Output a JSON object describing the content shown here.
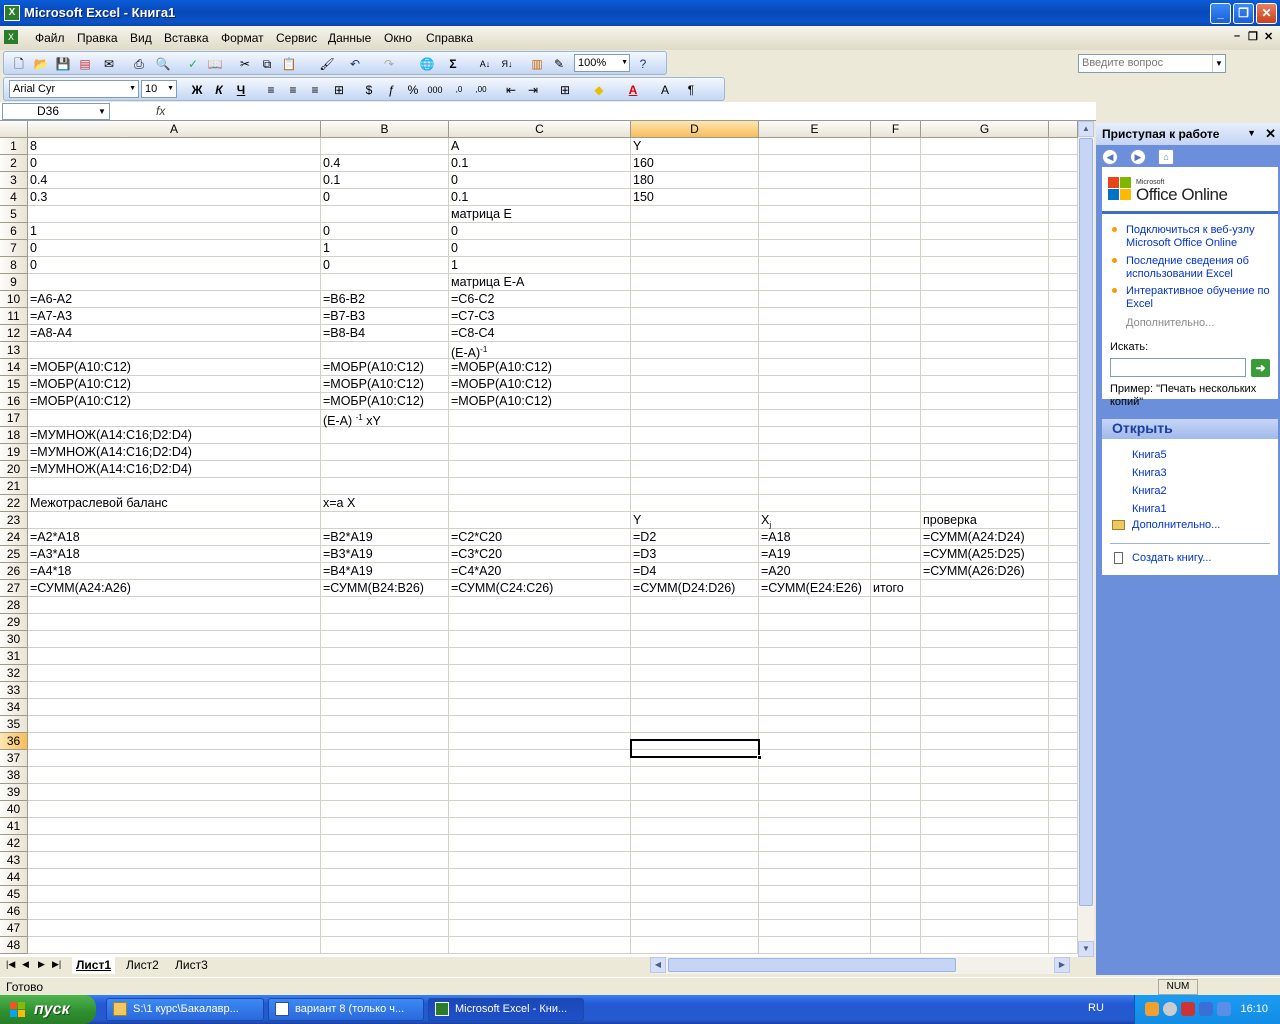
{
  "window": {
    "title": "Microsoft Excel - Книга1",
    "app_icon": "excel-icon"
  },
  "menu": {
    "items": [
      "Файл",
      "Правка",
      "Вид",
      "Вставка",
      "Формат",
      "Сервис",
      "Данные",
      "Окно",
      "Справка"
    ],
    "help_placeholder": "Введите вопрос"
  },
  "toolbar": {
    "zoom": "100%",
    "font_name": "Arial Cyr",
    "font_size": "10",
    "bold_label": "Ж",
    "italic_label": "К",
    "underline_label": "Ч"
  },
  "formula_bar": {
    "name_box": "D36",
    "fx": "fx",
    "content": ""
  },
  "columns": [
    "A",
    "B",
    "C",
    "D",
    "E",
    "F",
    "G"
  ],
  "selected_column": "D",
  "selected_row": 36,
  "rows": [
    {
      "n": 1,
      "A": "8",
      "C": "A",
      "D": "Y"
    },
    {
      "n": 2,
      "A": "0",
      "B": "0.4",
      "C": "0.1",
      "D": "160"
    },
    {
      "n": 3,
      "A": "0.4",
      "B": "0.1",
      "C": "0",
      "D": "180"
    },
    {
      "n": 4,
      "A": "0.3",
      "B": "0",
      "C": "0.1",
      "D": "150"
    },
    {
      "n": 5,
      "C": "матрица E"
    },
    {
      "n": 6,
      "A": "1",
      "B": "0",
      "C": "0"
    },
    {
      "n": 7,
      "A": "0",
      "B": "1",
      "C": "0"
    },
    {
      "n": 8,
      "A": "0",
      "B": "0",
      "C": "1"
    },
    {
      "n": 9,
      "C": "матрица E-A"
    },
    {
      "n": 10,
      "A": "=A6-A2",
      "B": "=B6-B2",
      "C": "=C6-C2"
    },
    {
      "n": 11,
      "A": "=A7-A3",
      "B": "=B7-B3",
      "C": "=C7-C3"
    },
    {
      "n": 12,
      "A": "=A8-A4",
      "B": "=B8-B4",
      "C": "=C8-C4"
    },
    {
      "n": 13,
      "C": "(E-A)",
      "C_sup": "-1"
    },
    {
      "n": 14,
      "A": "=МОБР(A10:C12)",
      "B": "=МОБР(A10:C12)",
      "C": "=МОБР(A10:C12)"
    },
    {
      "n": 15,
      "A": "=МОБР(A10:C12)",
      "B": "=МОБР(A10:C12)",
      "C": "=МОБР(A10:C12)"
    },
    {
      "n": 16,
      "A": "=МОБР(A10:C12)",
      "B": "=МОБР(A10:C12)",
      "C": "=МОБР(A10:C12)"
    },
    {
      "n": 17,
      "B": "(E-A) ",
      "B_sup": "-1",
      "B_after": " xY"
    },
    {
      "n": 18,
      "A": "=МУМНОЖ(A14:C16;D2:D4)"
    },
    {
      "n": 19,
      "A": "=МУМНОЖ(A14:C16;D2:D4)"
    },
    {
      "n": 20,
      "A": "=МУМНОЖ(A14:C16;D2:D4)"
    },
    {
      "n": 21
    },
    {
      "n": 22,
      "A": "Межотраслевой баланс",
      "B": "x=a X"
    },
    {
      "n": 23,
      "D": "Y",
      "E": "X",
      "E_sub": "j",
      "G": "проверка"
    },
    {
      "n": 24,
      "A": "=A2*A18",
      "B": "=B2*A19",
      "C": "=C2*C20",
      "D": "=D2",
      "E": "=A18",
      "G": "=СУММ(A24:D24)"
    },
    {
      "n": 25,
      "A": "=A3*A18",
      "B": "=B3*A19",
      "C": "=C3*C20",
      "D": "=D3",
      "E": "=A19",
      "G": "=СУММ(A25:D25)"
    },
    {
      "n": 26,
      "A": "=A4*18",
      "B": "=B4*A19",
      "C": "=C4*A20",
      "D": "=D4",
      "E": "=A20",
      "G": "=СУММ(A26:D26)"
    },
    {
      "n": 27,
      "A": "=СУММ(A24:A26)",
      "B": "=СУММ(B24:B26)",
      "C": "=СУММ(C24:C26)",
      "D": "=СУММ(D24:D26)",
      "E": "=СУММ(E24:E26)",
      "F": "итого"
    },
    {
      "n": 28
    },
    {
      "n": 29
    },
    {
      "n": 30
    },
    {
      "n": 31
    },
    {
      "n": 32
    },
    {
      "n": 33
    },
    {
      "n": 34
    },
    {
      "n": 35
    },
    {
      "n": 36
    },
    {
      "n": 37
    },
    {
      "n": 38
    },
    {
      "n": 39
    },
    {
      "n": 40
    },
    {
      "n": 41
    },
    {
      "n": 42
    },
    {
      "n": 43
    },
    {
      "n": 44
    },
    {
      "n": 45
    },
    {
      "n": 46
    },
    {
      "n": 47
    },
    {
      "n": 48
    }
  ],
  "sheet_tabs": [
    "Лист1",
    "Лист2",
    "Лист3"
  ],
  "active_tab": "Лист1",
  "status": {
    "text": "Готово",
    "num": "NUM"
  },
  "task_pane": {
    "title": "Приступая к работе",
    "office_online_small": "Microsoft",
    "office_online": "Office Online",
    "links": [
      "Подключиться к веб-узлу Microsoft Office Online",
      "Последние сведения об использовании Excel",
      "Интерактивное обучение по Excel"
    ],
    "more": "Дополнительно...",
    "search_label": "Искать:",
    "search_value": "",
    "example_label": "Пример:",
    "example_text": "\"Печать нескольких копий\"",
    "open_header": "Открыть",
    "recent": [
      "Книга5",
      "Книга3",
      "Книга2",
      "Книга1"
    ],
    "open_more": "Дополнительно...",
    "create": "Создать книгу..."
  },
  "taskbar": {
    "start": "пуск",
    "buttons": [
      "S:\\1 курс\\Бакалавр...",
      "вариант 8 (только ч...",
      "Microsoft Excel - Кни..."
    ],
    "lang": "RU",
    "clock": "16:10"
  }
}
